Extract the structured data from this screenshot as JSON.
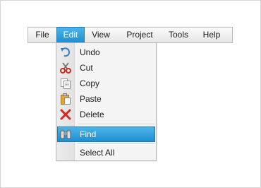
{
  "menubar": {
    "items": [
      {
        "label": "File"
      },
      {
        "label": "Edit",
        "active": true
      },
      {
        "label": "View"
      },
      {
        "label": "Project"
      },
      {
        "label": "Tools"
      },
      {
        "label": "Help"
      }
    ]
  },
  "edit_menu": {
    "items": [
      {
        "label": "Undo",
        "icon": "undo-icon"
      },
      {
        "label": "Cut",
        "icon": "scissors-icon"
      },
      {
        "label": "Copy",
        "icon": "copy-icon"
      },
      {
        "label": "Paste",
        "icon": "paste-icon"
      },
      {
        "label": "Delete",
        "icon": "delete-x-icon"
      },
      {
        "label": "Find",
        "icon": "binoculars-icon",
        "selected": true
      },
      {
        "label": "Select All",
        "icon": ""
      }
    ]
  },
  "colors": {
    "accent": "#2a9fdc",
    "accent_border": "#1b7ab2",
    "menu_background": "#f4f4f4",
    "delete_red": "#d9261c",
    "undo_blue": "#2f7fc8"
  }
}
